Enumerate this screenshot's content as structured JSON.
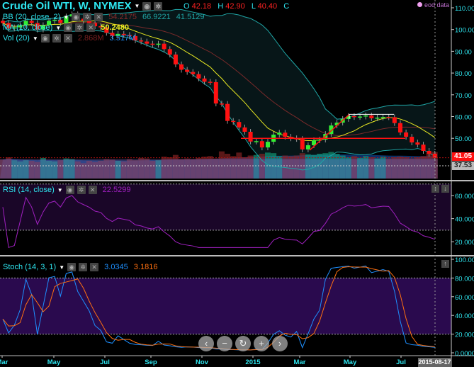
{
  "header": {
    "title": "Crude Oil WTI, W, NYMEX",
    "o_label": "O",
    "o": "42.18",
    "h_label": "H",
    "h": "42.90",
    "l_label": "L",
    "l": "40.40",
    "c_label": "C",
    "source": "eod data"
  },
  "legend": {
    "bb": {
      "label": "BB (20, close, 2)",
      "mid": "54.2175",
      "upper": "66.9221",
      "lower": "41.5129"
    },
    "ma": {
      "label": "MA (10, close)",
      "value": "50.2480"
    },
    "vol": {
      "label": "Vol (20)",
      "value": "2.868M",
      "ma": "3.517M"
    },
    "rsi": {
      "label": "RSI (14, close)",
      "value": "22.5299"
    },
    "stoch": {
      "label": "Stoch (14, 3, 1)",
      "k": "3.0345",
      "d": "3.1816"
    }
  },
  "price_labels": {
    "last": "41.05",
    "line": "37.53"
  },
  "cursor_date": "2015-08-17",
  "nav_buttons": [
    "‹",
    "−",
    "↻",
    "+",
    "›"
  ],
  "colors": {
    "bull": "#33ee33",
    "bear": "#ff1111",
    "ma": "#e8e822",
    "bb": "#1fa5a5",
    "bbmid": "#7a2a2a",
    "rsi": "#a020c0",
    "k": "#1e90ff",
    "d": "#ff7010",
    "axis": "#2ee6f0"
  },
  "chart_data": {
    "type": "candlestick",
    "title": "Crude Oil WTI, W, NYMEX",
    "x_ticks": [
      "Mar",
      "May",
      "Jul",
      "Sep",
      "Nov",
      "2015",
      "Mar",
      "May",
      "Jul"
    ],
    "price_axis": {
      "ticks": [
        "110.00",
        "100.00",
        "90.00",
        "80.00",
        "70.00",
        "60.00",
        "50.00"
      ],
      "range": [
        37,
        113
      ]
    },
    "rsi_axis": {
      "ticks": [
        "60.000",
        "40.000",
        "20.000"
      ],
      "bands": [
        70,
        30
      ]
    },
    "stoch_axis": {
      "ticks": [
        "100.00",
        "80.000",
        "60.000",
        "40.000",
        "20.000",
        "0.0000"
      ],
      "bands": [
        80,
        20
      ]
    },
    "closes": [
      103,
      100.5,
      101,
      102,
      104,
      103,
      100,
      102,
      104,
      104.5,
      103,
      106,
      107,
      105,
      104,
      103,
      101.5,
      101,
      98.5,
      97,
      98,
      97.5,
      97,
      95,
      94.5,
      93.5,
      93,
      93.5,
      91,
      88.5,
      84,
      81.5,
      80.5,
      79.5,
      77.5,
      76,
      75.8,
      66,
      65.8,
      58,
      57.5,
      55,
      53,
      48.5,
      48.7,
      45.8,
      48.4,
      51.7,
      52.6,
      50.7,
      50,
      49.7,
      44.9,
      46.8,
      49.1,
      49.4,
      52,
      55.9,
      57.2,
      58.9,
      60.2,
      59.8,
      60,
      60.5,
      59.2,
      59.5,
      59.8,
      59.7,
      57,
      52.7,
      50.7,
      48.1,
      47.1,
      44.2,
      42.9,
      41.05
    ],
    "volume_m": [
      3.2,
      3.6,
      3.1,
      2.9,
      3.1,
      3.0,
      2.8,
      3.5,
      3.0,
      2.9,
      3.1,
      3.4,
      3.3,
      2.9,
      2.6,
      3.0,
      2.8,
      3.0,
      3.3,
      3.2,
      3.0,
      2.9,
      3.3,
      3.1,
      3.5,
      3.4,
      3.0,
      3.1,
      3.7,
      3.6,
      4.0,
      3.3,
      3.4,
      3.3,
      3.5,
      3.7,
      3.8,
      3.4,
      4.6,
      4.2,
      3.8,
      4.4,
      3.6,
      3.9,
      4.0,
      4.2,
      4.4,
      4.3,
      3.8,
      3.9,
      3.8,
      3.9,
      4.3,
      4.1,
      4.0,
      4.2,
      4.3,
      4.5,
      4.2,
      3.9,
      3.6,
      3.8,
      3.5,
      3.8,
      3.6,
      3.4,
      3.7,
      3.4,
      3.6,
      3.7,
      3.6,
      3.4,
      3.6,
      3.8,
      4.4,
      4.5
    ],
    "annotations": {
      "support": 50,
      "resistance": 61,
      "last": 41.05
    }
  }
}
